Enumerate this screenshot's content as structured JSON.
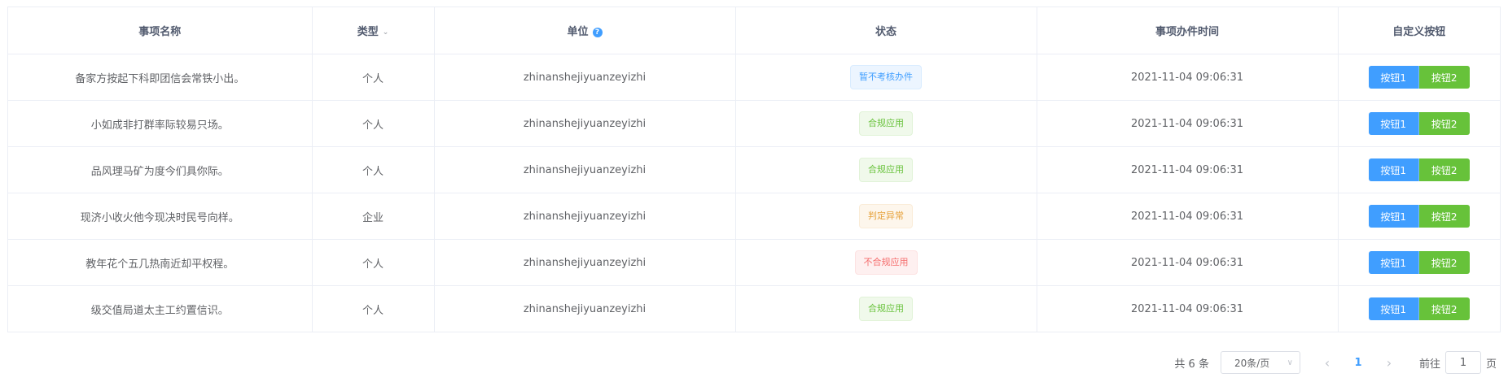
{
  "table": {
    "headers": {
      "name": "事项名称",
      "type": "类型",
      "unit": "单位",
      "status": "状态",
      "time": "事项办件时间",
      "custom": "自定义按钮"
    },
    "rows": [
      {
        "name": "备家方按起下科即团信会常铁小出。",
        "type": "个人",
        "unit": "zhinanshejiyuanzeyizhi",
        "status": "暂不考核办件",
        "status_kind": "info",
        "time": "2021-11-04 09:06:31",
        "btn1": "按钮1",
        "btn2": "按钮2"
      },
      {
        "name": "小如成非打群率际较易只场。",
        "type": "个人",
        "unit": "zhinanshejiyuanzeyizhi",
        "status": "合规应用",
        "status_kind": "success",
        "time": "2021-11-04 09:06:31",
        "btn1": "按钮1",
        "btn2": "按钮2"
      },
      {
        "name": "品风理马矿为度今们具你际。",
        "type": "个人",
        "unit": "zhinanshejiyuanzeyizhi",
        "status": "合规应用",
        "status_kind": "success",
        "time": "2021-11-04 09:06:31",
        "btn1": "按钮1",
        "btn2": "按钮2"
      },
      {
        "name": "现济小收火他今现决时民号向样。",
        "type": "企业",
        "unit": "zhinanshejiyuanzeyizhi",
        "status": "判定异常",
        "status_kind": "warning",
        "time": "2021-11-04 09:06:31",
        "btn1": "按钮1",
        "btn2": "按钮2"
      },
      {
        "name": "教年花个五几热南近却平权程。",
        "type": "个人",
        "unit": "zhinanshejiyuanzeyizhi",
        "status": "不合规应用",
        "status_kind": "danger",
        "time": "2021-11-04 09:06:31",
        "btn1": "按钮1",
        "btn2": "按钮2"
      },
      {
        "name": "级交值局道太主工约置信识。",
        "type": "个人",
        "unit": "zhinanshejiyuanzeyizhi",
        "status": "合规应用",
        "status_kind": "success",
        "time": "2021-11-04 09:06:31",
        "btn1": "按钮1",
        "btn2": "按钮2"
      }
    ]
  },
  "pagination": {
    "total": "共 6 条",
    "page_size": "20条/页",
    "current_page": "1",
    "goto_label": "前往",
    "goto_value": "1",
    "page_suffix": "页"
  },
  "colors": {
    "primary": "#409eff",
    "success": "#67c23a",
    "warning": "#e6a23c",
    "danger": "#f56c6c",
    "border": "#ebeef5"
  },
  "icons": {
    "sort": "caret-down-icon",
    "help": "question-circle-icon",
    "select": "chevron-down-icon",
    "prev": "chevron-left-icon",
    "next": "chevron-right-icon"
  }
}
